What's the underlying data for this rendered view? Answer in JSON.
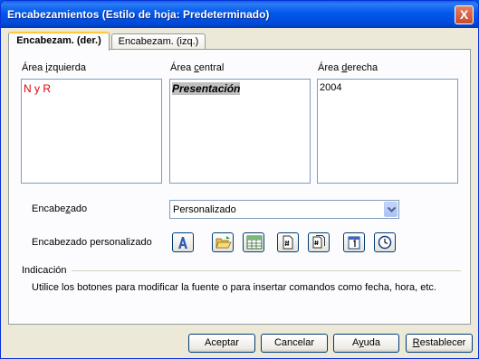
{
  "window": {
    "title": "Encabezamientos (Estilo de hoja: Predeterminado)",
    "close_label": "X"
  },
  "tabs": [
    {
      "label": "Encabezam. (der.)",
      "active": true
    },
    {
      "label": "Encabezam. (izq.)",
      "active": false
    }
  ],
  "areas": {
    "left": {
      "label_pre": "Área ",
      "label_u": "i",
      "label_post": "zquierda",
      "content": "N y R",
      "content_color": "#e00000"
    },
    "center": {
      "label_pre": "Área ",
      "label_u": "c",
      "label_post": "entral",
      "content": "Presentación"
    },
    "right": {
      "label_pre": "Área ",
      "label_u": "d",
      "label_post": "erecha",
      "content": "2004"
    }
  },
  "header_row": {
    "label_pre": "Encabe",
    "label_u": "z",
    "label_post": "ado",
    "value": "Personalizado"
  },
  "custom_header": {
    "label": "Encabezado personalizado"
  },
  "toolbar_icons": [
    "font-icon",
    "folder-open-icon",
    "table-icon",
    "page-number-icon",
    "page-count-icon",
    "date-icon",
    "time-icon"
  ],
  "hint": {
    "title": "Indicación",
    "text": "Utilice los botones para modificar la fuente o para insertar comandos como fecha, hora, etc."
  },
  "buttons": {
    "ok": "Aceptar",
    "cancel": "Cancelar",
    "help_pre": "A",
    "help_u": "y",
    "help_post": "uda",
    "reset_pre": "",
    "reset_u": "R",
    "reset_post": "establecer"
  },
  "colors": {
    "titlebar": "#0058ee",
    "dialog_bg": "#ece9d8",
    "tab_highlight": "#ffc83c"
  }
}
